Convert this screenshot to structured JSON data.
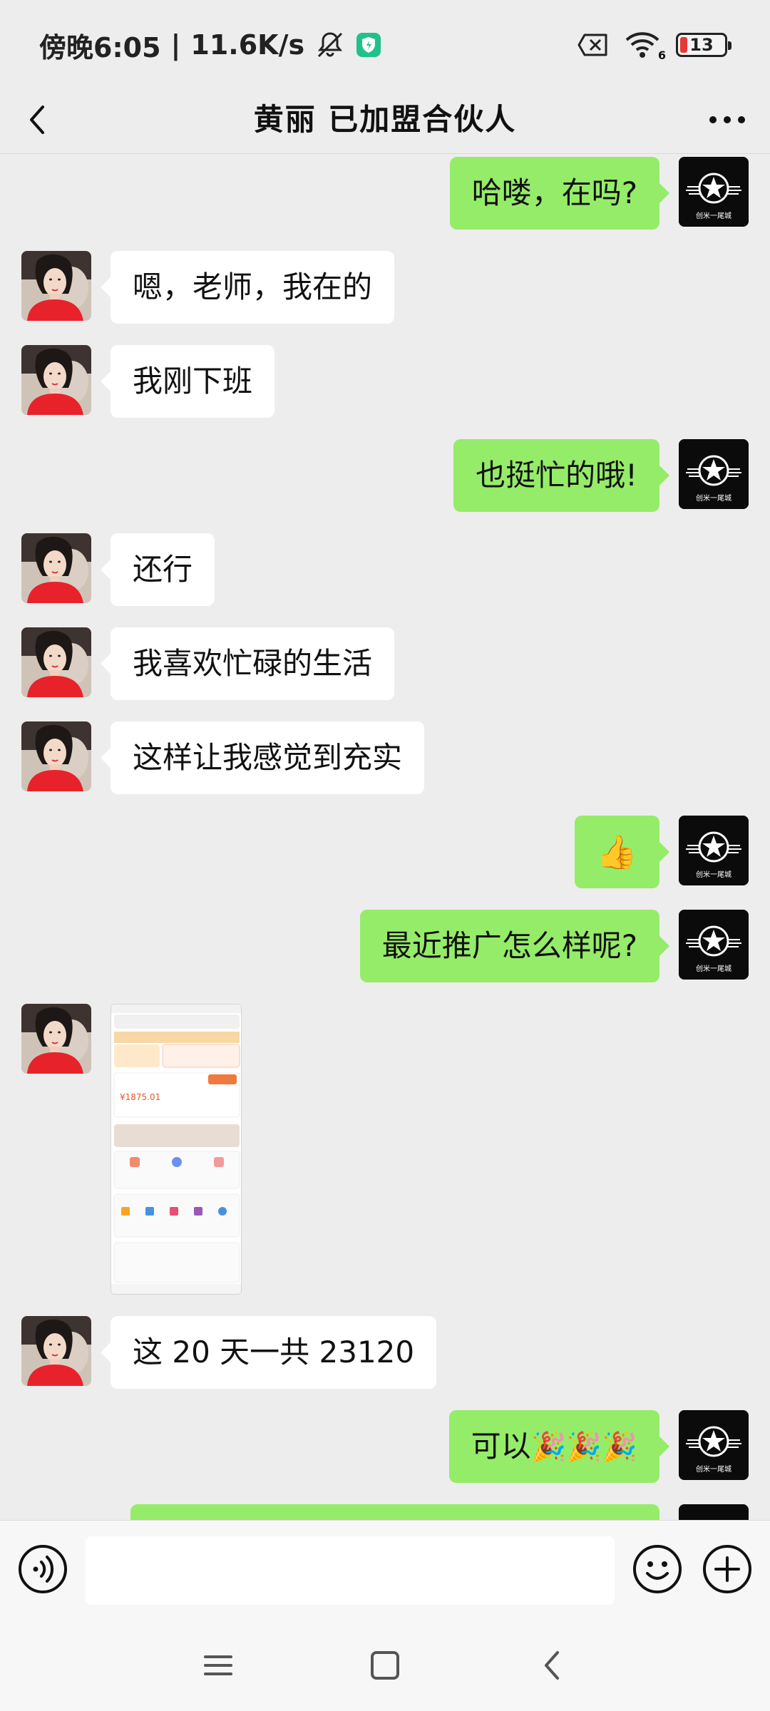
{
  "status_bar": {
    "time": "傍晚6:05",
    "separator": "|",
    "speed": "11.6K/s",
    "battery": "13",
    "wifi_label": "6",
    "icons": [
      "mute-bell-icon",
      "shield-app-icon",
      "no-sim-icon",
      "wifi-icon",
      "battery-icon"
    ]
  },
  "header": {
    "title": "黄丽  已加盟合伙人",
    "icons": [
      "back-arrow-icon",
      "more-options-icon"
    ]
  },
  "colors": {
    "sent_bubble": "#95ec69",
    "received_bubble": "#ffffff",
    "background": "#ededed",
    "received_avatar": "#e8222a",
    "sent_avatar": "#0b0b0b"
  },
  "sent_avatar_text": "创米一尾城",
  "messages": [
    {
      "side": "right",
      "text": "哈喽，在吗?"
    },
    {
      "side": "left",
      "text": "嗯，老师，我在的"
    },
    {
      "side": "left",
      "text": "我刚下班"
    },
    {
      "side": "right",
      "text": "也挺忙的哦!"
    },
    {
      "side": "left",
      "text": "还行"
    },
    {
      "side": "left",
      "text": "我喜欢忙碌的生活"
    },
    {
      "side": "left",
      "text": "这样让我感觉到充实"
    },
    {
      "side": "right",
      "text": "👍"
    },
    {
      "side": "right",
      "text": "最近推广怎么样呢?"
    },
    {
      "side": "left",
      "type": "image",
      "preview_amount": "¥1875.01"
    },
    {
      "side": "left",
      "text": "这 20 天一共 23120"
    },
    {
      "side": "right",
      "text": "可以",
      "emojis": "🎉🎉🎉"
    }
  ],
  "input": {
    "value": "",
    "placeholder": "",
    "icons": [
      "voice-icon",
      "emoji-icon",
      "plus-icon"
    ]
  },
  "system_nav": {
    "icons": [
      "menu-icon",
      "home-icon",
      "back-icon"
    ]
  }
}
